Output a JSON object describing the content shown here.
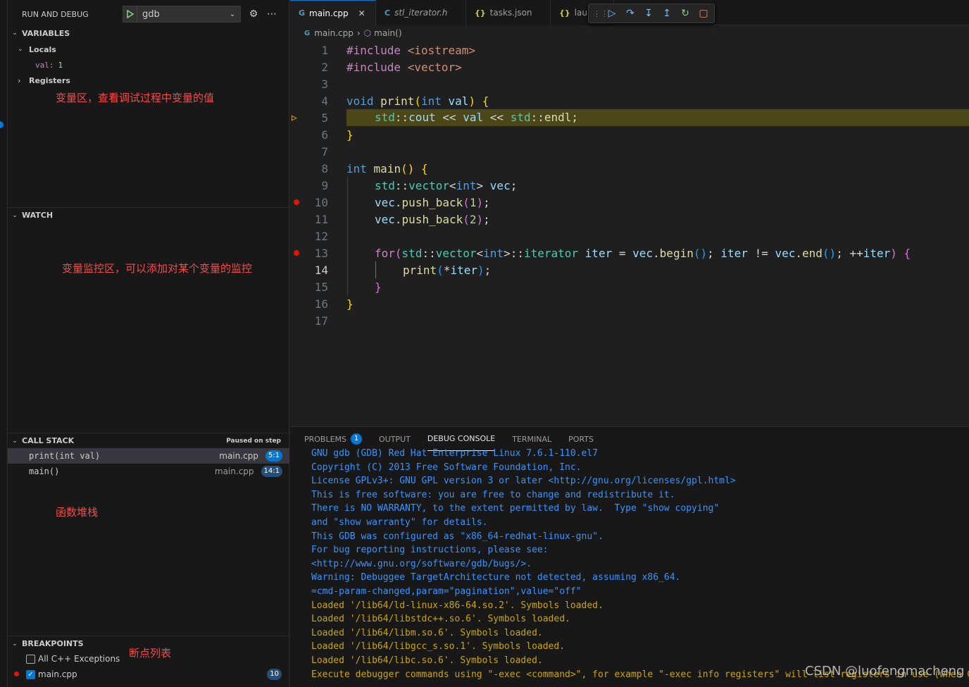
{
  "sidebar": {
    "title": "RUN AND DEBUG",
    "config": "gdb",
    "variables": {
      "header": "VARIABLES",
      "locals": "Locals",
      "var_name": "val:",
      "var_value": "1",
      "registers": "Registers",
      "annotation": "变量区，查看调试过程中变量的值"
    },
    "watch": {
      "header": "WATCH",
      "annotation": "变量监控区，可以添加对某个变量的监控"
    },
    "callstack": {
      "header": "CALL STACK",
      "status": "Paused on step",
      "frames": [
        {
          "name": "print(int val)",
          "file": "main.cpp",
          "pos": "5:1"
        },
        {
          "name": "main()",
          "file": "main.cpp",
          "pos": "14:1"
        }
      ],
      "annotation": "函数堆栈"
    },
    "breakpoints": {
      "header": "BREAKPOINTS",
      "annotation": "断点列表",
      "items": [
        {
          "label": "All C++ Exceptions",
          "checked": false
        },
        {
          "label": "main.cpp",
          "checked": true,
          "count": "10"
        }
      ]
    }
  },
  "tabs": [
    {
      "icon": "G",
      "label": "main.cpp",
      "active": true
    },
    {
      "icon": "C",
      "label": "stl_iterator.h"
    },
    {
      "icon": "{}",
      "label": "tasks.json"
    },
    {
      "icon": "{}",
      "label": "laun"
    }
  ],
  "breadcrumb": {
    "file": "main.cpp",
    "symbol": "main()"
  },
  "code": {
    "line_numbers": [
      "1",
      "2",
      "3",
      "4",
      "5",
      "6",
      "7",
      "8",
      "9",
      "10",
      "11",
      "12",
      "13",
      "14",
      "15",
      "16",
      "17"
    ],
    "current_line": "14"
  },
  "panel": {
    "tabs": [
      "PROBLEMS",
      "OUTPUT",
      "DEBUG CONSOLE",
      "TERMINAL",
      "PORTS"
    ],
    "problems_count": "1",
    "console": [
      "GNU gdb (GDB) Red Hat Enterprise Linux 7.6.1-110.el7",
      "Copyright (C) 2013 Free Software Foundation, Inc.",
      "License GPLv3+: GNU GPL version 3 or later <http://gnu.org/licenses/gpl.html>",
      "This is free software: you are free to change and redistribute it.",
      "There is NO WARRANTY, to the extent permitted by law.  Type \"show copying\"",
      "and \"show warranty\" for details.",
      "This GDB was configured as \"x86_64-redhat-linux-gnu\".",
      "For bug reporting instructions, please see:",
      "<http://www.gnu.org/software/gdb/bugs/>.",
      "Warning: Debuggee TargetArchitecture not detected, assuming x86_64.",
      "=cmd-param-changed,param=\"pagination\",value=\"off\"",
      "Loaded '/lib64/ld-linux-x86-64.so.2'. Symbols loaded.",
      "Loaded '/lib64/libstdc++.so.6'. Symbols loaded.",
      "Loaded '/lib64/libm.so.6'. Symbols loaded.",
      "Loaded '/lib64/libgcc_s.so.1'. Symbols loaded.",
      "Loaded '/lib64/libc.so.6'. Symbols loaded.",
      "Execute debugger commands using \"-exec <command>\", for example \"-exec info registers\" will list registers in use (when GDB"
    ]
  },
  "watermark": "CSDN @luofengmacheng"
}
